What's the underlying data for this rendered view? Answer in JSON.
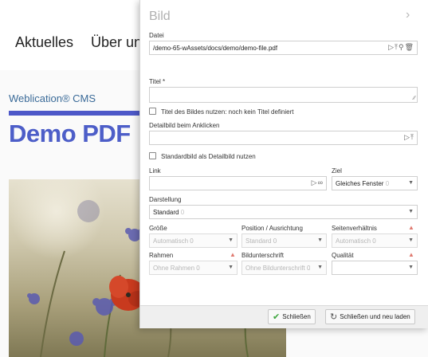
{
  "background": {
    "nav": [
      "Aktuelles",
      "Über un"
    ],
    "brand": "Weblication® CMS",
    "title": "Demo PDF"
  },
  "dialog": {
    "title": "Bild",
    "file": {
      "label": "Datei",
      "value": "/demo-65-wAssets/docs/demo/demo-file.pdf"
    },
    "titel": {
      "label": "Titel *",
      "value": ""
    },
    "use_title": {
      "label": "Titel des Bildes nutzen: noch kein Titel definiert"
    },
    "detail": {
      "label": "Detailbild beim Anklicken",
      "value": ""
    },
    "std_detail": {
      "label": "Standardbild als Detailbild nutzen"
    },
    "link": {
      "label": "Link",
      "value": ""
    },
    "ziel": {
      "label": "Ziel",
      "value": "Gleiches Fenster",
      "hint": "0"
    },
    "darstellung": {
      "label": "Darstellung",
      "value": "Standard",
      "hint": "0"
    },
    "groesse": {
      "label": "Größe",
      "value": "Automatisch",
      "hint": "0"
    },
    "position": {
      "label": "Position / Ausrichtung",
      "value": "Standard",
      "hint": "0"
    },
    "seitenverhaeltnis": {
      "label": "Seitenverhältnis",
      "value": "Automatisch",
      "hint": "0"
    },
    "rahmen": {
      "label": "Rahmen",
      "value": "Ohne Rahmen",
      "hint": "0"
    },
    "bildunterschrift": {
      "label": "Bildunterschrift",
      "value": "Ohne Bildunterschrift",
      "hint": "0"
    },
    "qualitaet": {
      "label": "Qualität",
      "value": ""
    },
    "buttons": {
      "close": "Schließen",
      "close_reload": "Schließen und neu laden"
    }
  },
  "colors": {
    "accent": "#4d5ec8",
    "required_pin": "#e07a70",
    "ok_check": "#3ea63e"
  }
}
